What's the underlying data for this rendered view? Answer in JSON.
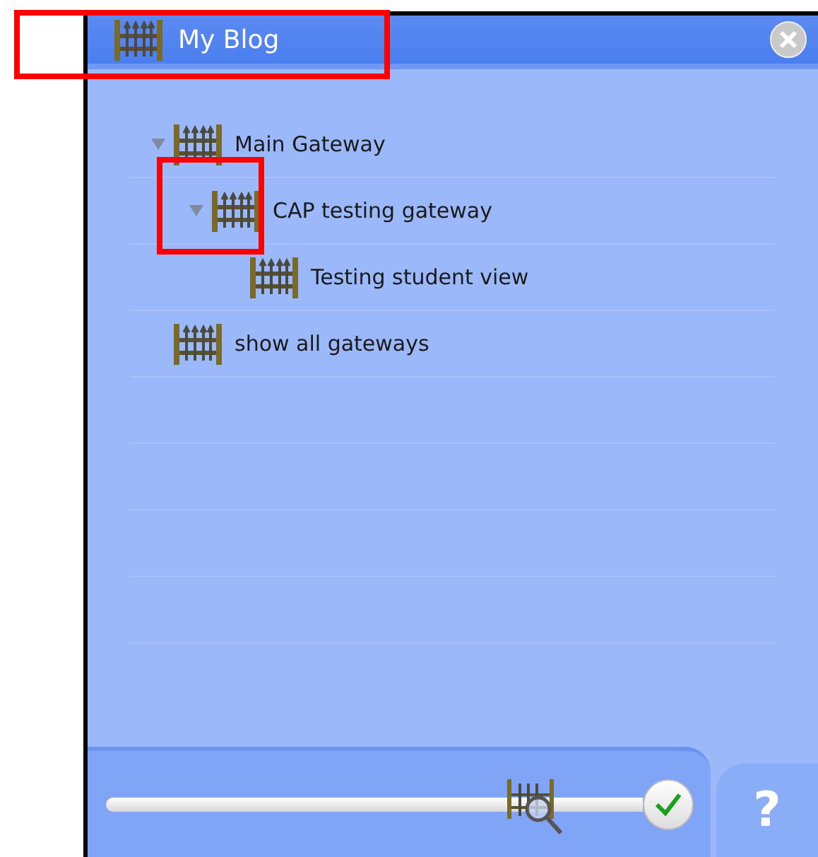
{
  "window": {
    "title": "My Blog",
    "title_highlighted": true
  },
  "tree": [
    {
      "label": "Main Gateway",
      "expanded": true,
      "children": [
        {
          "label": "CAP testing gateway",
          "expanded": true,
          "toggle_highlighted": true,
          "children": [
            {
              "label": "Testing student view"
            }
          ]
        }
      ]
    },
    {
      "label": "show all gateways"
    }
  ],
  "footer": {
    "slider": {
      "level": 0.8
    },
    "help": "?"
  }
}
